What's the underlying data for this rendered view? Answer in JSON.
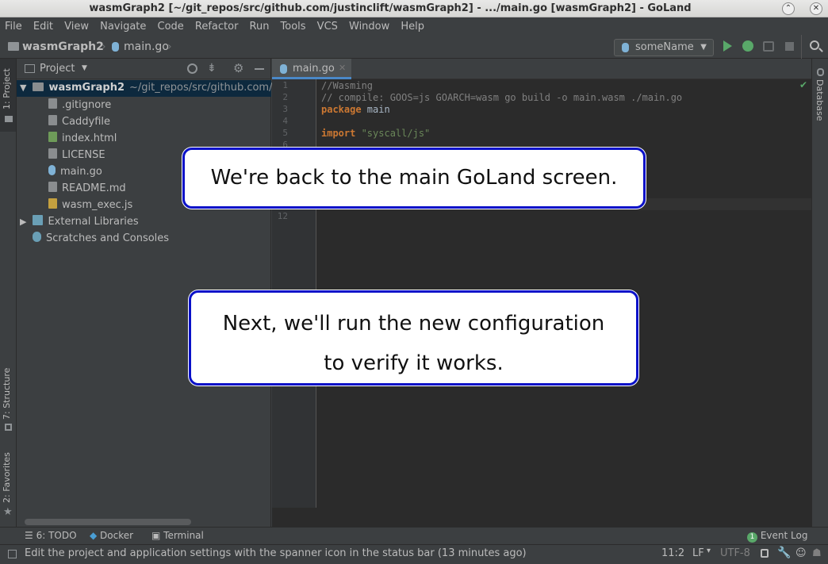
{
  "window": {
    "title": "wasmGraph2 [~/git_repos/src/github.com/justinclift/wasmGraph2] - .../main.go [wasmGraph2] - GoLand",
    "minimize_glyph": "⌃",
    "close_glyph": "✕"
  },
  "menu": [
    "File",
    "Edit",
    "View",
    "Navigate",
    "Code",
    "Refactor",
    "Run",
    "Tools",
    "VCS",
    "Window",
    "Help"
  ],
  "breadcrumb": {
    "project": "wasmGraph2",
    "file": "main.go"
  },
  "run_config": {
    "name": "someName"
  },
  "left_tool_tabs": {
    "project": "1: Project",
    "structure": "7: Structure",
    "favorites": "2: Favorites"
  },
  "right_tool_tabs": {
    "database": "Database"
  },
  "project_panel": {
    "title": "Project",
    "root": {
      "name": "wasmGraph2",
      "path": "~/git_repos/src/github.com/"
    },
    "files": [
      ".gitignore",
      "Caddyfile",
      "index.html",
      "LICENSE",
      "main.go",
      "README.md",
      "wasm_exec.js"
    ],
    "external": "External Libraries",
    "scratches": "Scratches and Consoles"
  },
  "editor": {
    "tab_label": "main.go",
    "line_numbers": [
      "1",
      "2",
      "3",
      "4",
      "5",
      "6",
      "12"
    ],
    "lines": {
      "l1": "//Wasming",
      "l2": "// compile: GOOS=js GOARCH=wasm go build -o main.wasm ./main.go",
      "l3_kw": "package",
      "l3_id": " main",
      "l5_kw": "import",
      "l5_str": " \"syscall/js\""
    }
  },
  "bottom_tabs": {
    "todo": "6: TODO",
    "docker": "Docker",
    "terminal": "Terminal",
    "event_log": "Event Log",
    "event_count": "1"
  },
  "status": {
    "message": "Edit the project and application settings with the spanner icon in the status bar (13 minutes ago)",
    "position": "11:2",
    "line_sep": "LF",
    "encoding": "UTF-8"
  },
  "callouts": {
    "first": "We're back to the main GoLand screen.",
    "second_line1": "Next, we'll run the new configuration",
    "second_line2": "to verify it works."
  },
  "colors": {
    "accent_run": "#59a869",
    "callout_border": "#0a11c8",
    "selection": "#0d293e"
  }
}
